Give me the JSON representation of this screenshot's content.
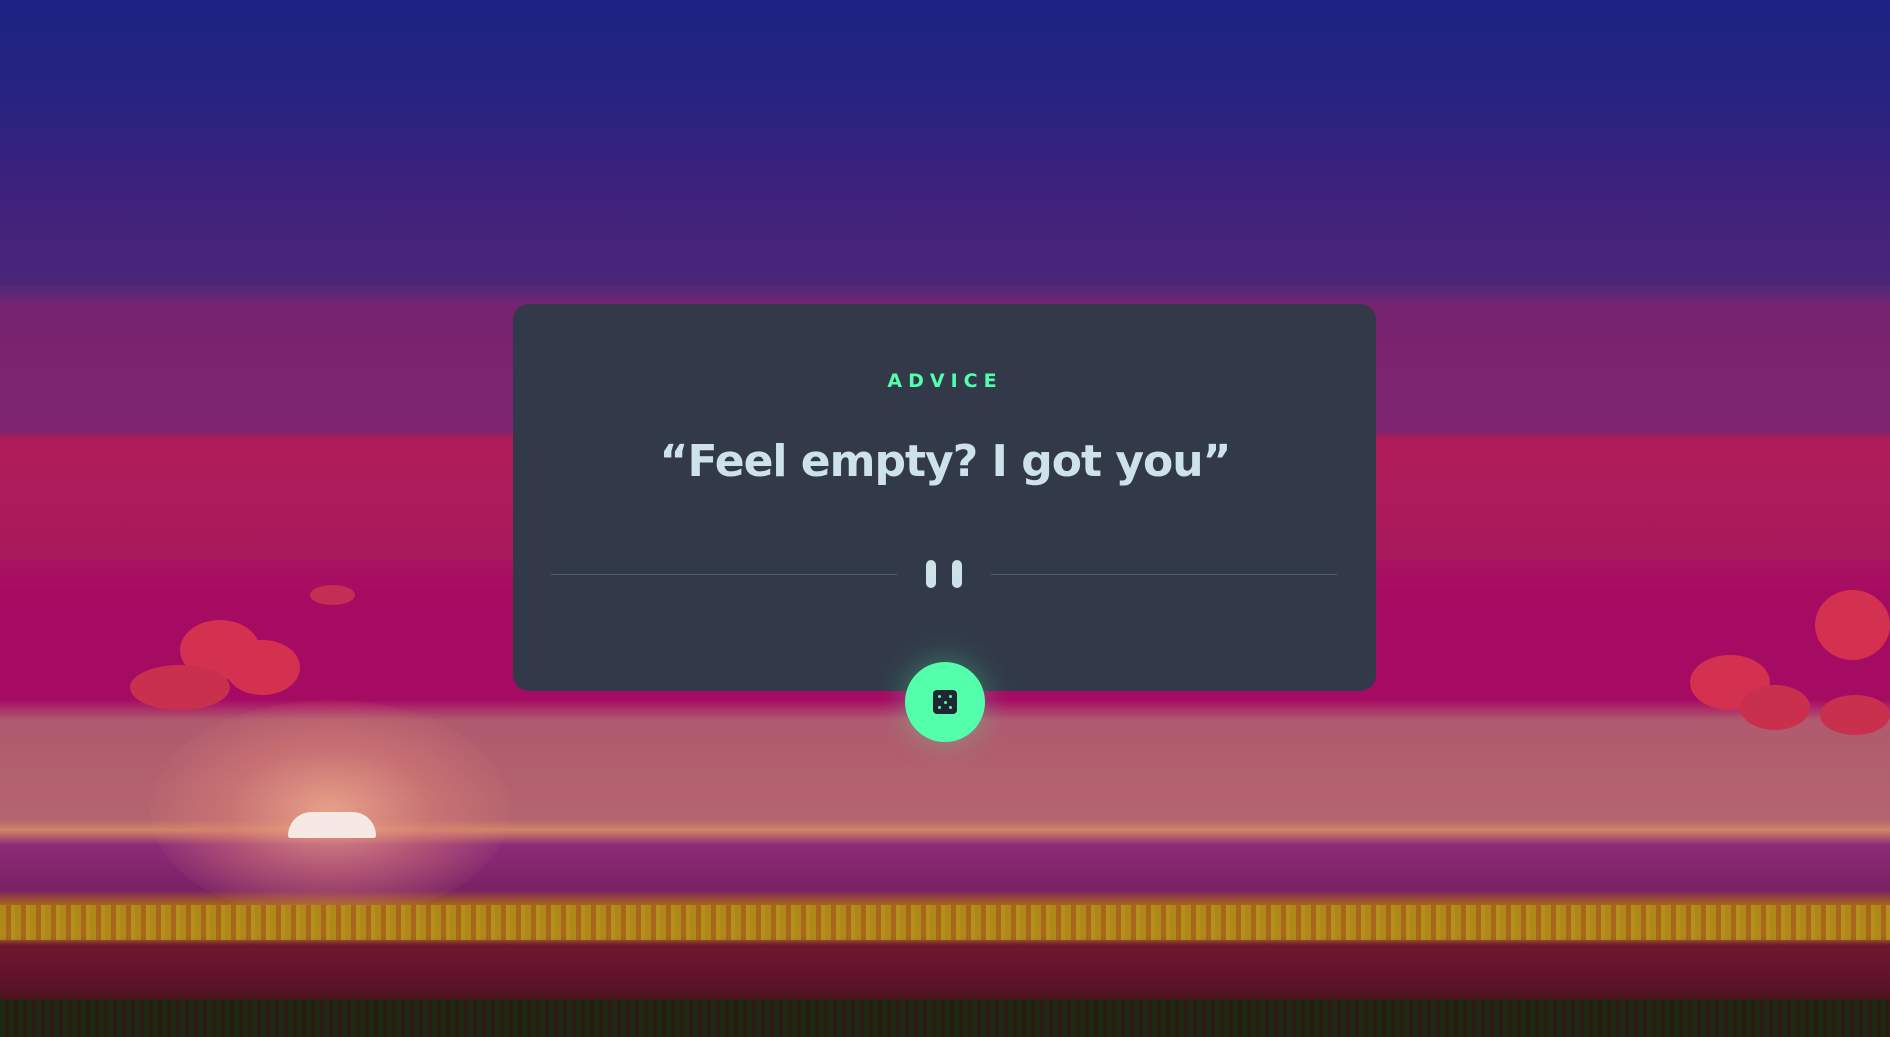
{
  "card": {
    "label": "ADVICE",
    "quote": "“Feel empty? I got you”"
  },
  "icons": {
    "divider": "pause-divider-icon",
    "generate": "dice-icon"
  },
  "colors": {
    "accent": "#53ffaa",
    "card_background": "#323a49",
    "quote_text": "#cee3e9",
    "divider": "#4f5d74"
  }
}
